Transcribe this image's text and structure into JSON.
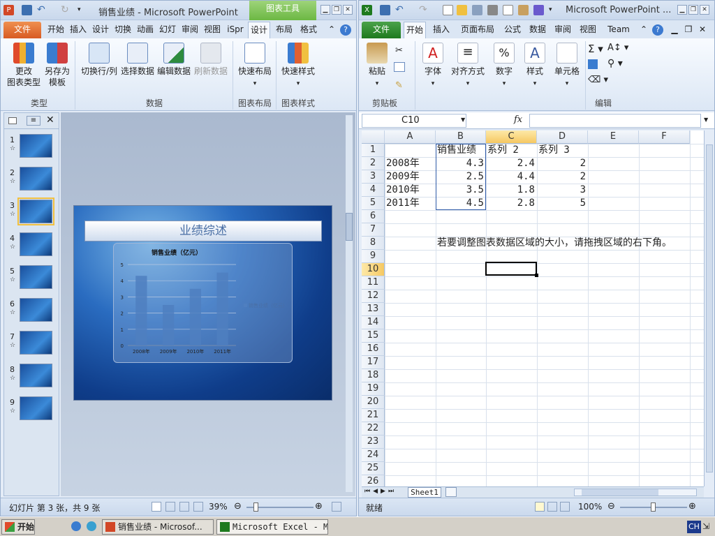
{
  "ppt": {
    "contextual_tab": "图表工具",
    "title": "销售业绩 - Microsoft PowerPoint",
    "tabs": [
      "文件",
      "开始",
      "插入",
      "设计",
      "切换",
      "动画",
      "幻灯",
      "审阅",
      "视图",
      "iSpr",
      "设计",
      "布局",
      "格式"
    ],
    "ribbon": {
      "b1": "更改\n图表类型",
      "b2": "另存为\n模板",
      "b3": "切换行/列",
      "b4": "选择数据",
      "b5": "编辑数据",
      "b6": "刷新数据",
      "b7": "快速布局",
      "b8": "快速样式",
      "g1": "类型",
      "g2": "数据",
      "g3": "图表布局",
      "g4": "图表样式"
    },
    "thumb_numbers": [
      "1",
      "2",
      "3",
      "4",
      "5",
      "6",
      "7",
      "8",
      "9"
    ],
    "slide_title": "业绩综述",
    "status": {
      "slide_info": "幻灯片 第 3 张，共 9 张",
      "zoom": "39%"
    }
  },
  "chart_data": {
    "type": "bar",
    "title": "销售业绩（亿元）",
    "categories": [
      "2008年",
      "2009年",
      "2010年",
      "2011年"
    ],
    "series": [
      {
        "name": "销售业绩（亿元）",
        "values": [
          4.3,
          2.5,
          3.5,
          4.5
        ]
      }
    ],
    "ylim": [
      0,
      5
    ],
    "yticks": [
      "0",
      "1",
      "2",
      "3",
      "4",
      "5"
    ],
    "legend": "right",
    "grid": true,
    "colors": {
      "bar": "#4f7fc0"
    }
  },
  "xls": {
    "title": "Microsoft PowerPoint ...",
    "tabs": [
      "文件",
      "开始",
      "插入",
      "页面布局",
      "公式",
      "数据",
      "审阅",
      "视图",
      "Team"
    ],
    "ribbon": {
      "b1": "粘贴",
      "b2": "字体",
      "b3": "对齐方式",
      "b4": "数字",
      "b5": "样式",
      "b6": "单元格",
      "g1": "剪贴板",
      "g2": "编辑"
    },
    "namebox": "C10",
    "fx": "fx",
    "columns": [
      "A",
      "B",
      "C",
      "D",
      "E",
      "F"
    ],
    "rows": [
      "1",
      "2",
      "3",
      "4",
      "5",
      "6",
      "7",
      "8",
      "9",
      "10",
      "11",
      "12",
      "13",
      "14",
      "15",
      "16",
      "17",
      "18",
      "19",
      "20",
      "21",
      "22",
      "23",
      "24",
      "25",
      "26"
    ],
    "cells": {
      "B1": "销售业绩",
      "C1": "系列 2",
      "D1": "系列 3",
      "A2": "2008年",
      "B2": "4.3",
      "C2": "2.4",
      "D2": "2",
      "A3": "2009年",
      "B3": "2.5",
      "C3": "4.4",
      "D3": "2",
      "A4": "2010年",
      "B4": "3.5",
      "C4": "1.8",
      "D4": "3",
      "A5": "2011年",
      "B5": "4.5",
      "C5": "2.8",
      "D5": "5",
      "B8": "若要调整图表数据区域的大小，请拖拽区域的右下角。"
    },
    "sheet_tab": "Sheet1",
    "status": {
      "ready": "就绪",
      "zoom": "100%"
    }
  },
  "taskbar": {
    "start": "开始",
    "ppt_task": "销售业绩 - Microsof...",
    "xls_task": "Microsoft Excel - M...",
    "lang": "CH"
  }
}
